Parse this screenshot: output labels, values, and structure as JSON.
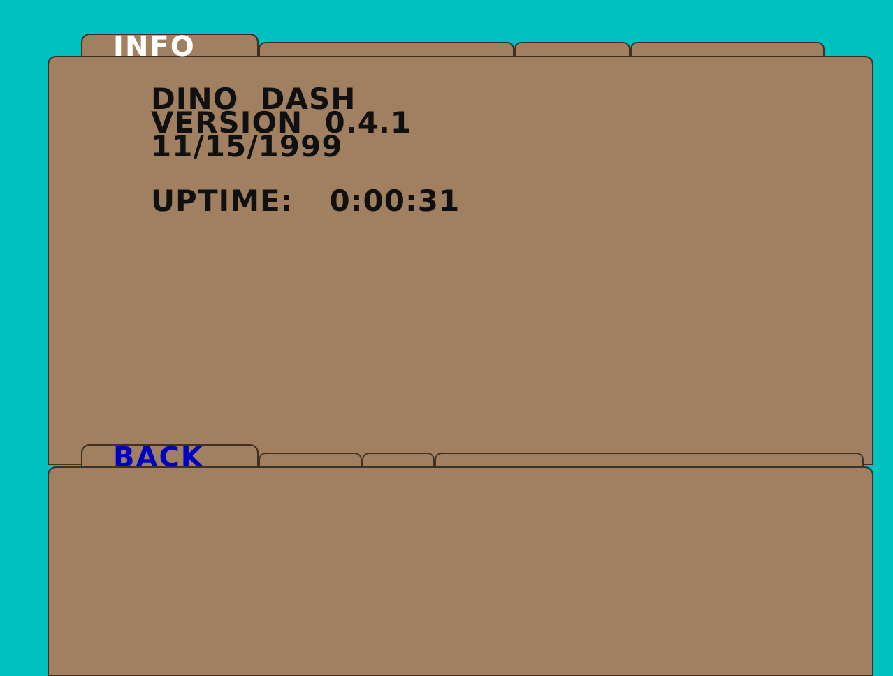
{
  "panels": [
    {
      "tab": {
        "label": "INFO",
        "selected": true
      },
      "lines": [
        "DINO  DASH",
        "VERSION  0.4.1",
        "11/15/1999"
      ],
      "uptime": {
        "label": "UPTIME:",
        "value": "0:00:31"
      }
    },
    {
      "tab": {
        "label": "BACK",
        "selected": false
      }
    }
  ]
}
